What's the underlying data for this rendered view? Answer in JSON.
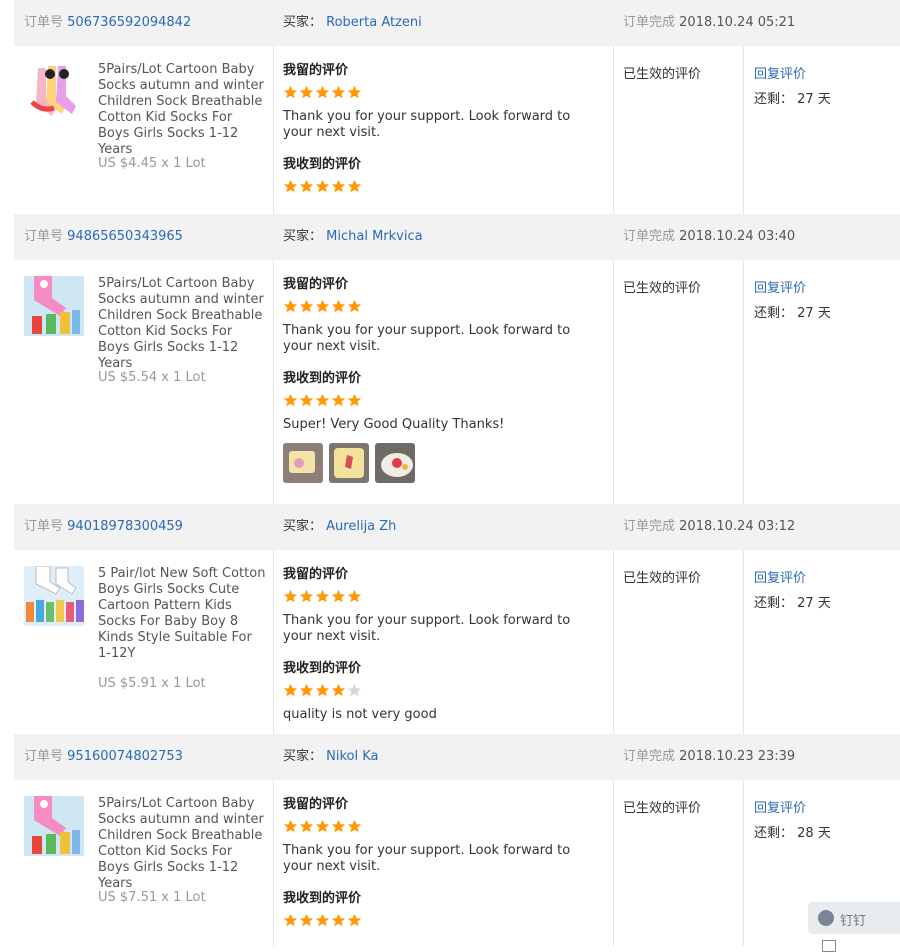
{
  "labels": {
    "order_no": "订单号",
    "buyer": "买家：",
    "completed": "订单完成",
    "my_review": "我留的评价",
    "received_review": "我收到的评价",
    "effective": "已生效的评价",
    "reply": "回复评价",
    "remaining": "还剩：",
    "days_unit": "天"
  },
  "colors": {
    "link": "#2a6ab5",
    "star": "#ff9900",
    "header_bg": "#f2f2f2"
  },
  "orders": [
    {
      "order_id": "506736592094842",
      "buyer": "Roberta Atzeni",
      "completed_at": "2018.10.24 05:21",
      "product": "5Pairs/Lot Cartoon Baby Socks autumn and winter Children Sock Breathable Cotton Kid Socks For Boys Girls Socks 1-12 Years",
      "price": "US $4.45 x 1 Lot",
      "my_stars": 5,
      "my_text": "Thank you for your support. Look forward to your next visit.",
      "recv_stars": 5,
      "recv_text": "",
      "days_left": "27"
    },
    {
      "order_id": "94865650343965",
      "buyer": "Michal Mrkvica",
      "completed_at": "2018.10.24 03:40",
      "product": "5Pairs/Lot Cartoon Baby Socks autumn and winter Children Sock Breathable Cotton Kid Socks For Boys Girls Socks 1-12 Years",
      "price": "US $5.54 x 1 Lot",
      "my_stars": 5,
      "my_text": "Thank you for your support. Look forward to your next visit.",
      "recv_stars": 5,
      "recv_text": "Super! Very Good Quality Thanks!",
      "days_left": "27"
    },
    {
      "order_id": "94018978300459",
      "buyer": "Aurelija Zh",
      "completed_at": "2018.10.24 03:12",
      "product": "5 Pair/lot New Soft Cotton Boys Girls Socks Cute Cartoon Pattern Kids Socks For Baby Boy 8 Kinds Style Suitable For 1-12Y",
      "price": "US $5.91 x 1 Lot",
      "my_stars": 5,
      "my_text": "Thank you for your support. Look forward to your next visit.",
      "recv_stars": 4,
      "recv_text": "quality is not very good",
      "days_left": "27"
    },
    {
      "order_id": "95160074802753",
      "buyer": "Nikol Ka",
      "completed_at": "2018.10.23 23:39",
      "product": "5Pairs/Lot Cartoon Baby Socks autumn and winter Children Sock Breathable Cotton Kid Socks For Boys Girls Socks 1-12 Years",
      "price": "US $7.51 x 1 Lot",
      "my_stars": 5,
      "my_text": "Thank you for your support. Look forward to your next visit.",
      "recv_stars": 5,
      "recv_text": "",
      "days_left": "28"
    }
  ],
  "widget": {
    "label": "钉钉"
  }
}
